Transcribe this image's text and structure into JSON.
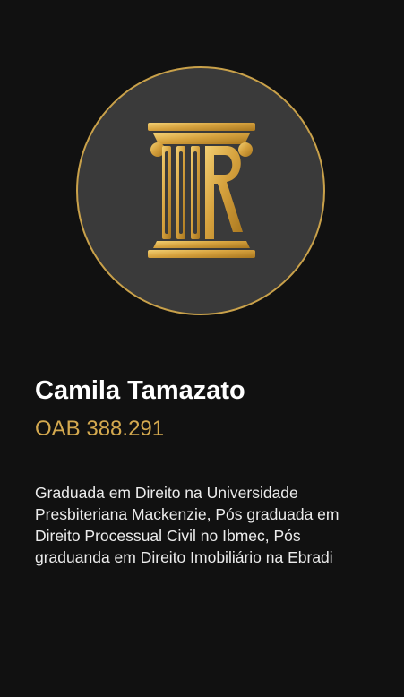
{
  "profile": {
    "name": "Camila Tamazato",
    "registration": "OAB 388.291",
    "bio": "Graduada em Direito na Universidade Presbiteriana Mackenzie, Pós graduada em Direito Processual Civil no Ibmec, Pós graduanda em Direito Imobiliário na Ebradi"
  },
  "logo": {
    "icon": "column-monogram-icon",
    "circle_color": "#3a3a3a",
    "border_color": "#c9a14a",
    "gold": "#d4a94f"
  },
  "colors": {
    "background": "#111111",
    "name": "#ffffff",
    "accent": "#d4a94f",
    "bio_text": "#ececec"
  }
}
